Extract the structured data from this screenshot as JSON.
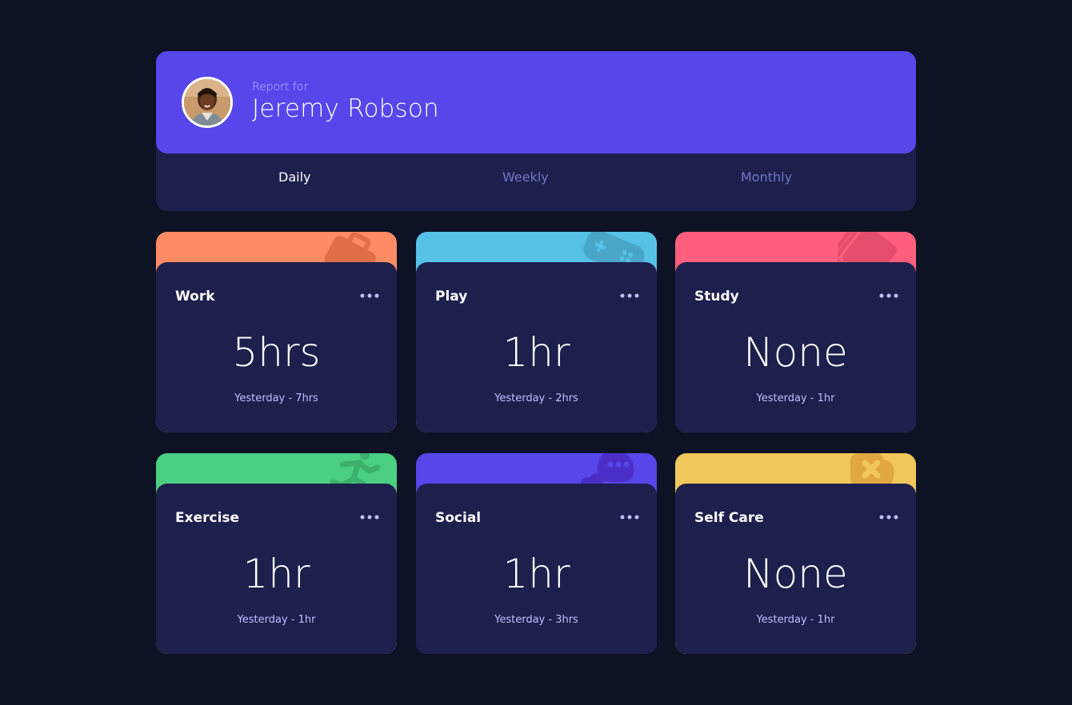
{
  "profile": {
    "report_label": "Report for",
    "name": "Jeremy Robson"
  },
  "tabs": [
    {
      "label": "Daily",
      "active": true
    },
    {
      "label": "Weekly",
      "active": false
    },
    {
      "label": "Monthly",
      "active": false
    }
  ],
  "activities": [
    {
      "title": "Work",
      "current": "5hrs",
      "previous": "Yesterday - 7hrs",
      "color": "#ff8b64",
      "icon": "briefcase-icon"
    },
    {
      "title": "Play",
      "current": "1hr",
      "previous": "Yesterday - 2hrs",
      "color": "#55c2e6",
      "icon": "gamepad-icon"
    },
    {
      "title": "Study",
      "current": "None",
      "previous": "Yesterday - 1hr",
      "color": "#ff5e7d",
      "icon": "book-icon"
    },
    {
      "title": "Exercise",
      "current": "1hr",
      "previous": "Yesterday - 1hr",
      "color": "#4bcf82",
      "icon": "running-icon"
    },
    {
      "title": "Social",
      "current": "1hr",
      "previous": "Yesterday - 3hrs",
      "color": "#5746ea",
      "icon": "social-icon"
    },
    {
      "title": "Self Care",
      "current": "None",
      "previous": "Yesterday - 1hr",
      "color": "#f1c75b",
      "icon": "self-care-icon"
    }
  ],
  "colors": {
    "background": "#0d1224",
    "card": "#1d1f4c",
    "accent": "#5746ea",
    "muted_text": "#bdc1ff",
    "inactive_tab": "#7078c9"
  }
}
